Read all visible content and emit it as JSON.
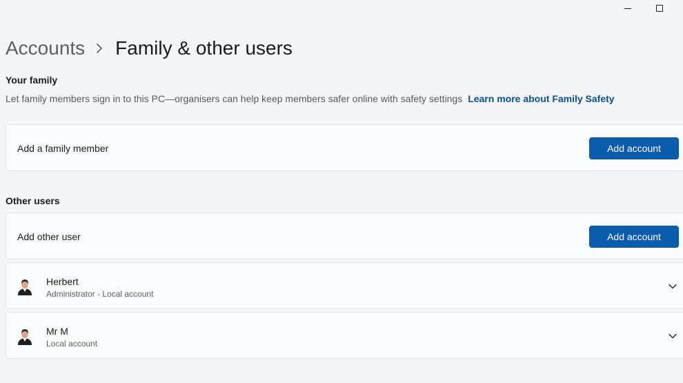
{
  "breadcrumb": {
    "parent": "Accounts",
    "current": "Family & other users"
  },
  "family": {
    "title": "Your family",
    "description": "Let family members sign in to this PC—organisers can help keep members safer online with safety settings",
    "link": "Learn more about Family Safety",
    "card_label": "Add a family member",
    "button_label": "Add account"
  },
  "other_users": {
    "title": "Other users",
    "card_label": "Add other user",
    "button_label": "Add account",
    "users": [
      {
        "name": "Herbert",
        "detail": "Administrator - Local account"
      },
      {
        "name": "Mr M",
        "detail": "Local account"
      }
    ]
  },
  "colors": {
    "accent": "#0b5cad",
    "link": "#0a4f96",
    "background": "#f3f5f9",
    "card": "#fafbfd"
  },
  "icons": {
    "minimize": "minimize-icon",
    "maximize": "maximize-icon",
    "separator": "chevron-right-icon",
    "expand": "chevron-down-icon",
    "avatar": "user-avatar-icon"
  }
}
